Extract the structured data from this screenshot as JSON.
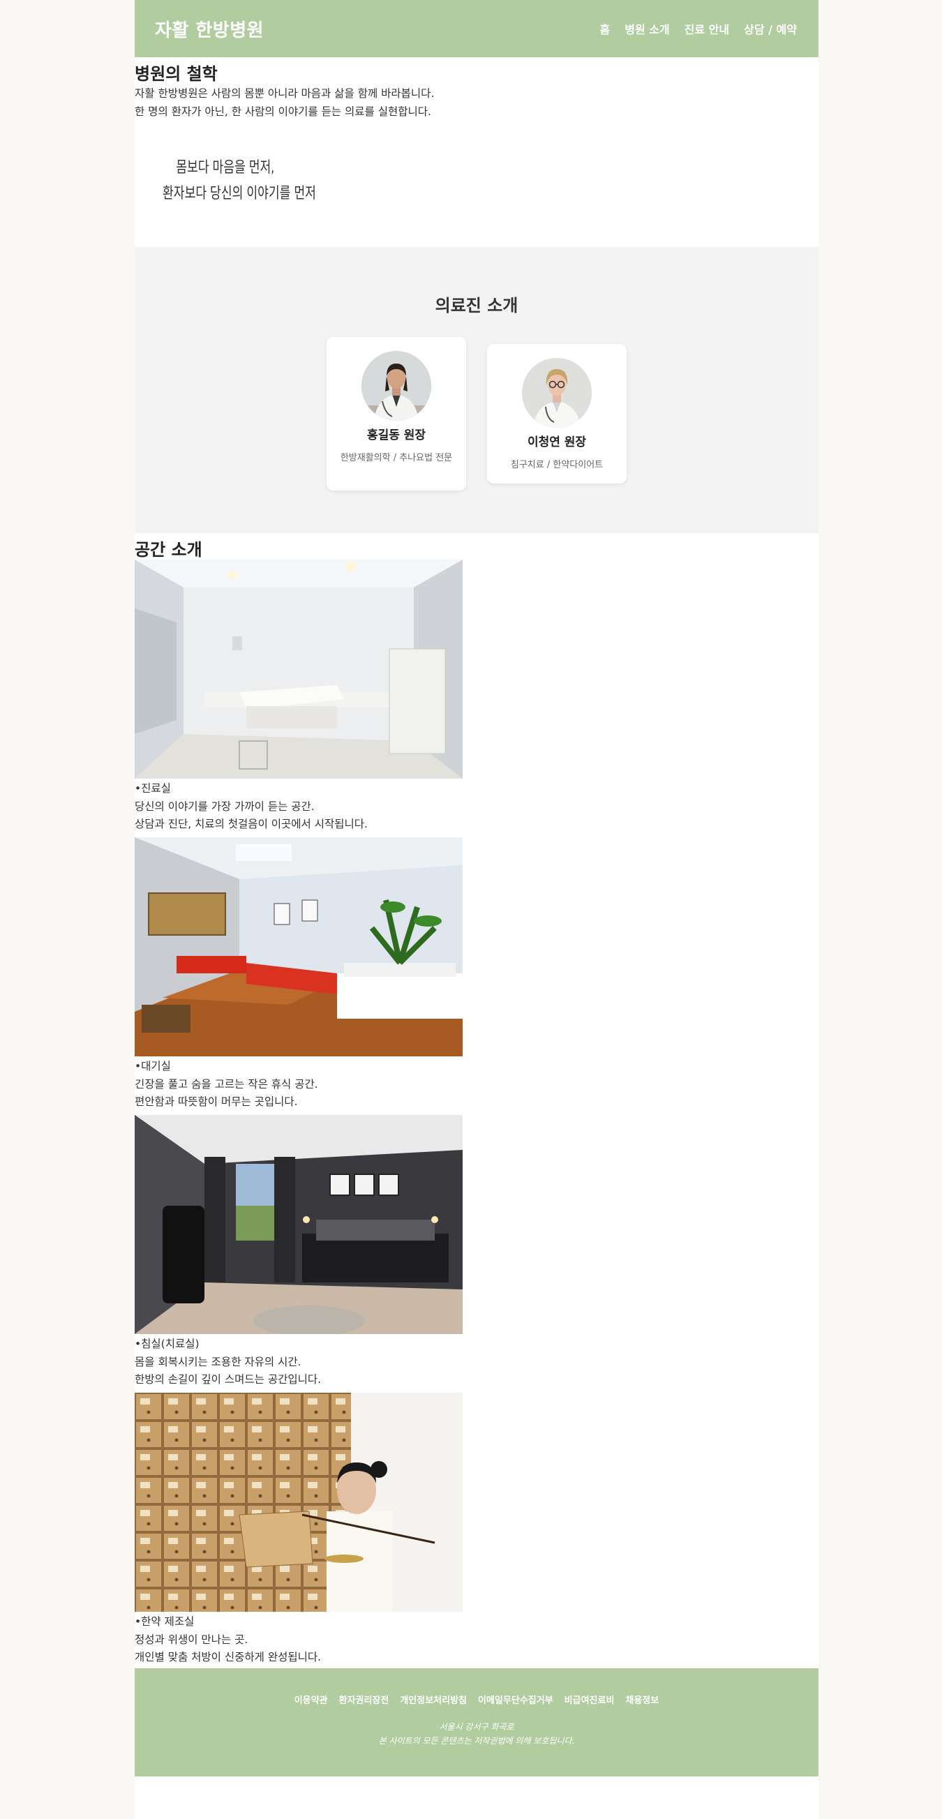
{
  "header": {
    "logo": "자활 한방병원",
    "nav": [
      "홈",
      "병원 소개",
      "진료 안내",
      "상담 / 예약"
    ]
  },
  "philosophy": {
    "title": "병원의 철학",
    "line1": "자활 한방병원은 사람의 몸뿐 아니라 마음과 삶을 함께 바라봅니다.",
    "line2": "한 명의 환자가 아닌, 한 사람의 이야기를 듣는 의료를 실현합니다.",
    "quote1": "몸보다 마음을 먼저,",
    "quote2": "환자보다 당신의 이야기를 먼저"
  },
  "doctors": {
    "title": "의료진 소개",
    "list": [
      {
        "name": "홍길동 원장",
        "specialty": "한방재활의학 / 추나요법 전문"
      },
      {
        "name": "이청연 원장",
        "specialty": "침구치료 / 한약다이어트"
      }
    ]
  },
  "spaces": {
    "title": "공간 소개",
    "rooms": [
      {
        "title": "•진료실",
        "line1": "당신의 이야기를 가장 가까이 듣는 공간.",
        "line2": "상담과 진단, 치료의 첫걸음이 이곳에서 시작됩니다."
      },
      {
        "title": "•대기실",
        "line1": "긴장을 풀고 숨을 고르는 작은 휴식 공간.",
        "line2": "편안함과 따뜻함이 머무는 곳입니다."
      },
      {
        "title": "•침실(치료실)",
        "line1": "몸을 회복시키는 조용한 자유의 시간.",
        "line2": "한방의 손길이 깊이 스며드는 공간입니다."
      },
      {
        "title": "•한약 제조실",
        "line1": "정성과 위생이 만나는 곳.",
        "line2": "개인별 맞춤 처방이 신중하게 완성됩니다."
      }
    ]
  },
  "footer": {
    "links": [
      "이용약관",
      "환자권리장전",
      "개인정보처리방침",
      "이메일무단수집거부",
      "비급여진료비",
      "채용정보"
    ],
    "address": "서울시 강서구 화곡로",
    "copyright": "본 사이트의 모든 콘텐츠는 저작권법에 의해 보호됩니다."
  }
}
